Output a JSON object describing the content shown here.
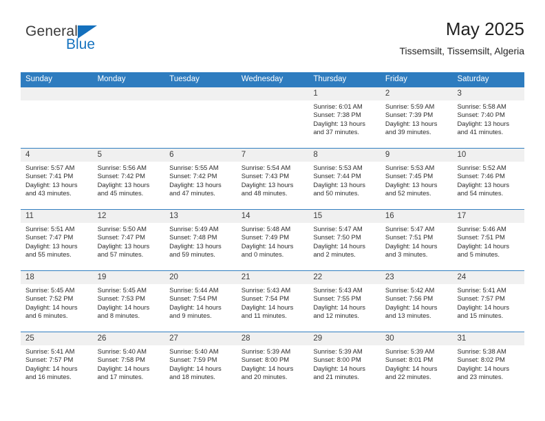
{
  "brand": {
    "name_part1": "General",
    "name_part2": "Blue",
    "triangle_color": "#1470bd"
  },
  "header": {
    "title": "May 2025",
    "subtitle": "Tissemsilt, Tissemsilt, Algeria"
  },
  "theme": {
    "header_bar": "#2e7cbf",
    "date_band": "#f0f0f0",
    "text": "#2b2b2b"
  },
  "weekday_headers": [
    "Sunday",
    "Monday",
    "Tuesday",
    "Wednesday",
    "Thursday",
    "Friday",
    "Saturday"
  ],
  "weeks": [
    [
      {
        "day": "",
        "sunrise": "",
        "sunset": "",
        "daylight_line1": "",
        "daylight_line2": "",
        "empty": true
      },
      {
        "day": "",
        "sunrise": "",
        "sunset": "",
        "daylight_line1": "",
        "daylight_line2": "",
        "empty": true
      },
      {
        "day": "",
        "sunrise": "",
        "sunset": "",
        "daylight_line1": "",
        "daylight_line2": "",
        "empty": true
      },
      {
        "day": "",
        "sunrise": "",
        "sunset": "",
        "daylight_line1": "",
        "daylight_line2": "",
        "empty": true
      },
      {
        "day": "1",
        "sunrise": "Sunrise: 6:01 AM",
        "sunset": "Sunset: 7:38 PM",
        "daylight_line1": "Daylight: 13 hours",
        "daylight_line2": "and 37 minutes."
      },
      {
        "day": "2",
        "sunrise": "Sunrise: 5:59 AM",
        "sunset": "Sunset: 7:39 PM",
        "daylight_line1": "Daylight: 13 hours",
        "daylight_line2": "and 39 minutes."
      },
      {
        "day": "3",
        "sunrise": "Sunrise: 5:58 AM",
        "sunset": "Sunset: 7:40 PM",
        "daylight_line1": "Daylight: 13 hours",
        "daylight_line2": "and 41 minutes."
      }
    ],
    [
      {
        "day": "4",
        "sunrise": "Sunrise: 5:57 AM",
        "sunset": "Sunset: 7:41 PM",
        "daylight_line1": "Daylight: 13 hours",
        "daylight_line2": "and 43 minutes."
      },
      {
        "day": "5",
        "sunrise": "Sunrise: 5:56 AM",
        "sunset": "Sunset: 7:42 PM",
        "daylight_line1": "Daylight: 13 hours",
        "daylight_line2": "and 45 minutes."
      },
      {
        "day": "6",
        "sunrise": "Sunrise: 5:55 AM",
        "sunset": "Sunset: 7:42 PM",
        "daylight_line1": "Daylight: 13 hours",
        "daylight_line2": "and 47 minutes."
      },
      {
        "day": "7",
        "sunrise": "Sunrise: 5:54 AM",
        "sunset": "Sunset: 7:43 PM",
        "daylight_line1": "Daylight: 13 hours",
        "daylight_line2": "and 48 minutes."
      },
      {
        "day": "8",
        "sunrise": "Sunrise: 5:53 AM",
        "sunset": "Sunset: 7:44 PM",
        "daylight_line1": "Daylight: 13 hours",
        "daylight_line2": "and 50 minutes."
      },
      {
        "day": "9",
        "sunrise": "Sunrise: 5:53 AM",
        "sunset": "Sunset: 7:45 PM",
        "daylight_line1": "Daylight: 13 hours",
        "daylight_line2": "and 52 minutes."
      },
      {
        "day": "10",
        "sunrise": "Sunrise: 5:52 AM",
        "sunset": "Sunset: 7:46 PM",
        "daylight_line1": "Daylight: 13 hours",
        "daylight_line2": "and 54 minutes."
      }
    ],
    [
      {
        "day": "11",
        "sunrise": "Sunrise: 5:51 AM",
        "sunset": "Sunset: 7:47 PM",
        "daylight_line1": "Daylight: 13 hours",
        "daylight_line2": "and 55 minutes."
      },
      {
        "day": "12",
        "sunrise": "Sunrise: 5:50 AM",
        "sunset": "Sunset: 7:47 PM",
        "daylight_line1": "Daylight: 13 hours",
        "daylight_line2": "and 57 minutes."
      },
      {
        "day": "13",
        "sunrise": "Sunrise: 5:49 AM",
        "sunset": "Sunset: 7:48 PM",
        "daylight_line1": "Daylight: 13 hours",
        "daylight_line2": "and 59 minutes."
      },
      {
        "day": "14",
        "sunrise": "Sunrise: 5:48 AM",
        "sunset": "Sunset: 7:49 PM",
        "daylight_line1": "Daylight: 14 hours",
        "daylight_line2": "and 0 minutes."
      },
      {
        "day": "15",
        "sunrise": "Sunrise: 5:47 AM",
        "sunset": "Sunset: 7:50 PM",
        "daylight_line1": "Daylight: 14 hours",
        "daylight_line2": "and 2 minutes."
      },
      {
        "day": "16",
        "sunrise": "Sunrise: 5:47 AM",
        "sunset": "Sunset: 7:51 PM",
        "daylight_line1": "Daylight: 14 hours",
        "daylight_line2": "and 3 minutes."
      },
      {
        "day": "17",
        "sunrise": "Sunrise: 5:46 AM",
        "sunset": "Sunset: 7:51 PM",
        "daylight_line1": "Daylight: 14 hours",
        "daylight_line2": "and 5 minutes."
      }
    ],
    [
      {
        "day": "18",
        "sunrise": "Sunrise: 5:45 AM",
        "sunset": "Sunset: 7:52 PM",
        "daylight_line1": "Daylight: 14 hours",
        "daylight_line2": "and 6 minutes."
      },
      {
        "day": "19",
        "sunrise": "Sunrise: 5:45 AM",
        "sunset": "Sunset: 7:53 PM",
        "daylight_line1": "Daylight: 14 hours",
        "daylight_line2": "and 8 minutes."
      },
      {
        "day": "20",
        "sunrise": "Sunrise: 5:44 AM",
        "sunset": "Sunset: 7:54 PM",
        "daylight_line1": "Daylight: 14 hours",
        "daylight_line2": "and 9 minutes."
      },
      {
        "day": "21",
        "sunrise": "Sunrise: 5:43 AM",
        "sunset": "Sunset: 7:54 PM",
        "daylight_line1": "Daylight: 14 hours",
        "daylight_line2": "and 11 minutes."
      },
      {
        "day": "22",
        "sunrise": "Sunrise: 5:43 AM",
        "sunset": "Sunset: 7:55 PM",
        "daylight_line1": "Daylight: 14 hours",
        "daylight_line2": "and 12 minutes."
      },
      {
        "day": "23",
        "sunrise": "Sunrise: 5:42 AM",
        "sunset": "Sunset: 7:56 PM",
        "daylight_line1": "Daylight: 14 hours",
        "daylight_line2": "and 13 minutes."
      },
      {
        "day": "24",
        "sunrise": "Sunrise: 5:41 AM",
        "sunset": "Sunset: 7:57 PM",
        "daylight_line1": "Daylight: 14 hours",
        "daylight_line2": "and 15 minutes."
      }
    ],
    [
      {
        "day": "25",
        "sunrise": "Sunrise: 5:41 AM",
        "sunset": "Sunset: 7:57 PM",
        "daylight_line1": "Daylight: 14 hours",
        "daylight_line2": "and 16 minutes."
      },
      {
        "day": "26",
        "sunrise": "Sunrise: 5:40 AM",
        "sunset": "Sunset: 7:58 PM",
        "daylight_line1": "Daylight: 14 hours",
        "daylight_line2": "and 17 minutes."
      },
      {
        "day": "27",
        "sunrise": "Sunrise: 5:40 AM",
        "sunset": "Sunset: 7:59 PM",
        "daylight_line1": "Daylight: 14 hours",
        "daylight_line2": "and 18 minutes."
      },
      {
        "day": "28",
        "sunrise": "Sunrise: 5:39 AM",
        "sunset": "Sunset: 8:00 PM",
        "daylight_line1": "Daylight: 14 hours",
        "daylight_line2": "and 20 minutes."
      },
      {
        "day": "29",
        "sunrise": "Sunrise: 5:39 AM",
        "sunset": "Sunset: 8:00 PM",
        "daylight_line1": "Daylight: 14 hours",
        "daylight_line2": "and 21 minutes."
      },
      {
        "day": "30",
        "sunrise": "Sunrise: 5:39 AM",
        "sunset": "Sunset: 8:01 PM",
        "daylight_line1": "Daylight: 14 hours",
        "daylight_line2": "and 22 minutes."
      },
      {
        "day": "31",
        "sunrise": "Sunrise: 5:38 AM",
        "sunset": "Sunset: 8:02 PM",
        "daylight_line1": "Daylight: 14 hours",
        "daylight_line2": "and 23 minutes."
      }
    ]
  ]
}
